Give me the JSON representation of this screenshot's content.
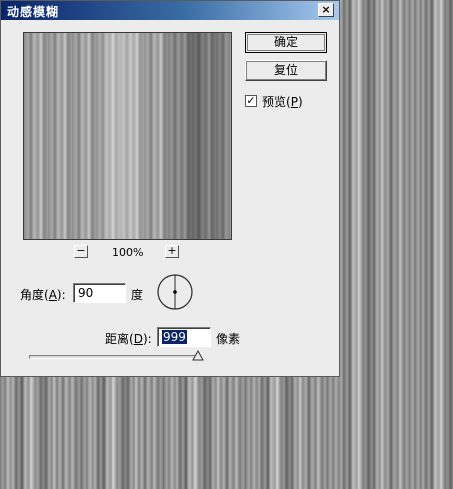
{
  "dialog": {
    "title": "动感模糊",
    "close_glyph": "×"
  },
  "preview": {
    "zoom_out_glyph": "−",
    "zoom_in_glyph": "+",
    "zoom_level": "100%"
  },
  "buttons": {
    "ok_label": "确定",
    "reset_label": "复位"
  },
  "preview_toggle": {
    "label_prefix": "预览(",
    "label_key": "P",
    "label_suffix": ")",
    "checked": true,
    "check_glyph": "✓"
  },
  "angle": {
    "label_prefix": "角度(",
    "label_key": "A",
    "label_suffix": "):",
    "value": "90",
    "unit": "度"
  },
  "distance": {
    "label_prefix": "距离(",
    "label_key": "D",
    "label_suffix": "):",
    "value": "999",
    "unit": "像素",
    "slider_fraction": 1.0
  },
  "colors": {
    "title_gradient_start": "#0a246a",
    "title_gradient_end": "#a6caf0",
    "selection": "#0a246a"
  }
}
